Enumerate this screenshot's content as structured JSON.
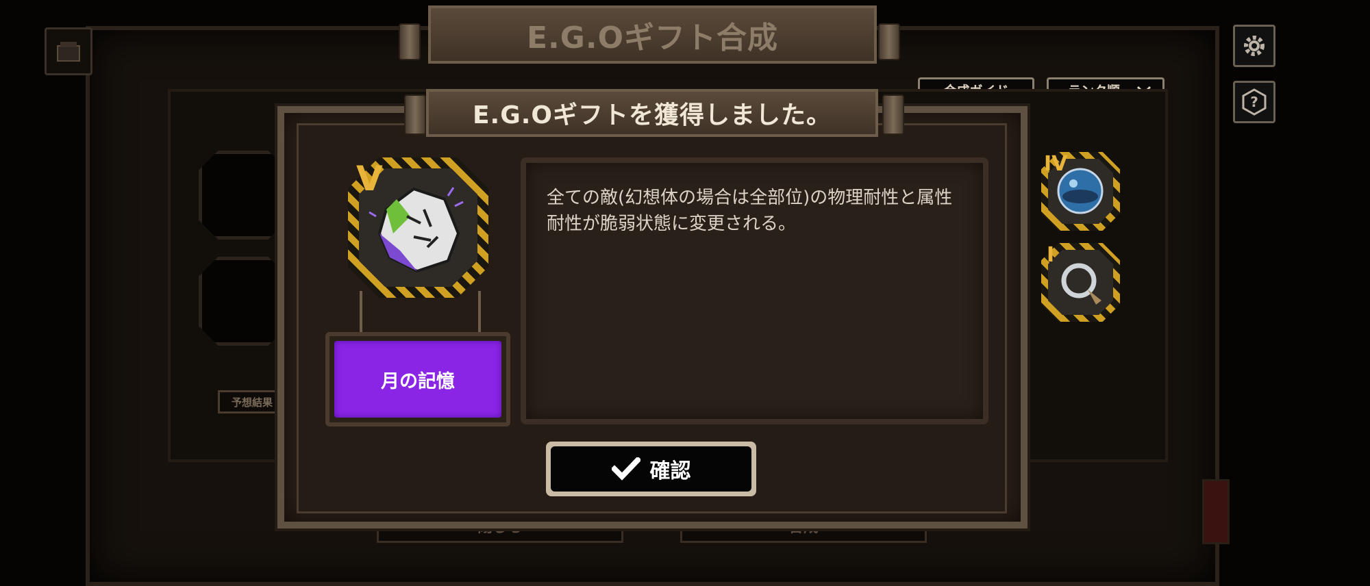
{
  "main_panel": {
    "title": "E.G.Oギフト合成",
    "guide_button_label": "合成ガイド",
    "sort_select": {
      "selected": "ランク順"
    },
    "forecast_label": "予想結果",
    "right_gifts": [
      {
        "rank": "IV",
        "icon": "blue-orb-icon"
      },
      {
        "rank": "I",
        "icon": "ring-icon"
      }
    ],
    "bottom_buttons": [
      "閉じる",
      "合成"
    ]
  },
  "side_icons": [
    "settings-gear-icon",
    "help-icon"
  ],
  "dialog": {
    "title": "E.G.Oギフトを獲得しました。",
    "gift": {
      "rank": "V",
      "name": "月の記憶",
      "name_bg_color": "#8a25e6",
      "icon": "moon-rock-icon"
    },
    "description": "全ての敵(幻想体の場合は全部位)の物理耐性と属性耐性が脆弱状態に変更される。",
    "confirm_label": "確認",
    "confirm_icon": "check-icon"
  },
  "colors": {
    "rank_gold": "#e8b43a",
    "hazard_yellow": "#d0a022"
  }
}
